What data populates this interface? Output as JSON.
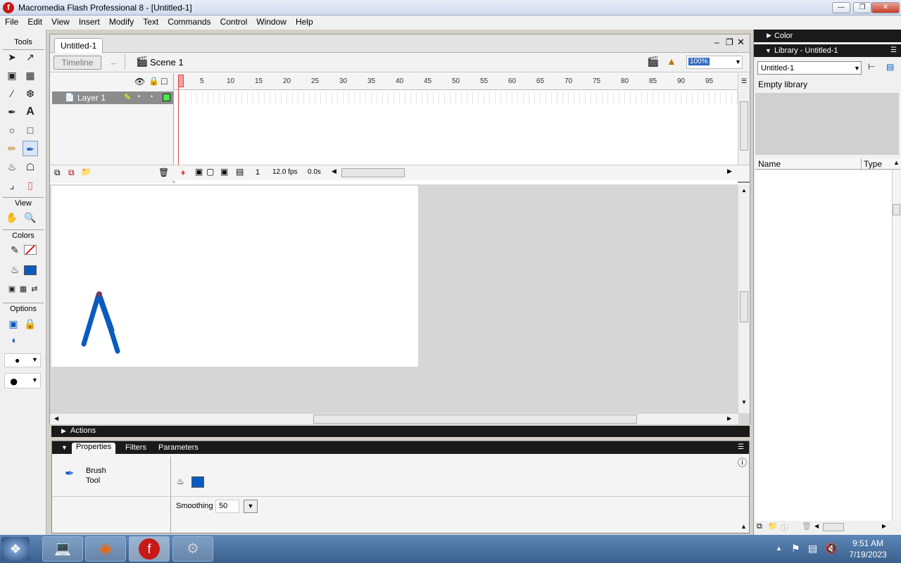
{
  "window": {
    "title": "Macromedia Flash Professional 8 - [Untitled-1]",
    "app_icon": "f"
  },
  "menu": [
    "File",
    "Edit",
    "View",
    "Insert",
    "Modify",
    "Text",
    "Commands",
    "Control",
    "Window",
    "Help"
  ],
  "tools": {
    "title": "Tools",
    "view_label": "View",
    "colors_label": "Colors",
    "options_label": "Options"
  },
  "document": {
    "tab": "Untitled-1",
    "timeline_button": "Timeline",
    "scene": "Scene 1",
    "zoom": "100%"
  },
  "timeline": {
    "layer_name": "Layer 1",
    "ticks": [
      "1",
      "5",
      "10",
      "15",
      "20",
      "25",
      "30",
      "35",
      "40",
      "45",
      "50",
      "55",
      "60",
      "65",
      "70",
      "75",
      "80",
      "85",
      "90",
      "95"
    ],
    "current_frame": "1",
    "fps": "12.0 fps",
    "elapsed": "0.0s"
  },
  "panels": {
    "actions": "Actions",
    "tabs": [
      "Properties",
      "Filters",
      "Parameters"
    ],
    "tool_name_line1": "Brush",
    "tool_name_line2": "Tool",
    "smoothing_label": "Smoothing",
    "smoothing_value": "50"
  },
  "right": {
    "color_header": "Color",
    "library_header": "Library - Untitled-1",
    "library_select": "Untitled-1",
    "library_status": "Empty library",
    "col_name": "Name",
    "col_type": "Type"
  },
  "colors": {
    "fill": "#0a5bbf",
    "stroke": "#000000",
    "playhead": "#dd4444",
    "layer_row": "#8c8c8c"
  },
  "taskbar": {
    "time": "9:51 AM",
    "date": "7/19/2023"
  }
}
